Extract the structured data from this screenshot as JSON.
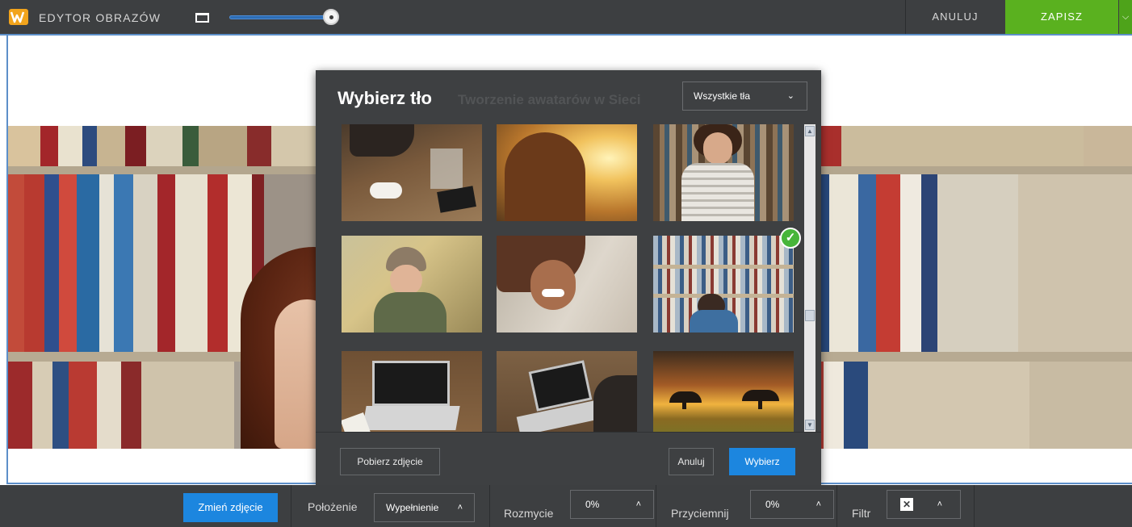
{
  "topbar": {
    "title": "EDYTOR OBRAZÓW",
    "logo_icon": "w-logo-icon",
    "cancel_label": "ANULUJ",
    "save_label": "ZAPISZ",
    "zoom_level": 1.0,
    "colors": {
      "bar": "#3d3f41",
      "save": "#5ab11f",
      "accent": "#5d8fc9"
    }
  },
  "modal": {
    "title": "Wybierz tło",
    "background_caption": "Tworzenie awatarów w Sieci",
    "filter_select": {
      "value": "Wszystkie tła"
    },
    "thumbnails": [
      {
        "name": "cafe-table-photo",
        "selected": false
      },
      {
        "name": "sunset-field-woman-photo",
        "selected": false
      },
      {
        "name": "library-woman-smiling-photo",
        "selected": false
      },
      {
        "name": "autumn-woman-hat-photo",
        "selected": false
      },
      {
        "name": "laughing-woman-hair-photo",
        "selected": false
      },
      {
        "name": "library-reading-photo",
        "selected": true
      },
      {
        "name": "laptop-desk-photo",
        "selected": false
      },
      {
        "name": "typing-laptop-photo",
        "selected": false
      },
      {
        "name": "savanna-sunset-photo",
        "selected": false
      }
    ],
    "download_label": "Pobierz zdjęcie",
    "cancel_label": "Anuluj",
    "choose_label": "Wybierz"
  },
  "toolbar": {
    "change_photo_label": "Zmień zdjęcie",
    "position_label": "Położenie",
    "position_value": "Wypełnienie",
    "blur_label": "Rozmycie",
    "blur_value": "0%",
    "darken_label": "Przyciemnij",
    "darken_value": "0%",
    "filter_label": "Filtr",
    "colors": {
      "button": "#1c86df"
    }
  }
}
